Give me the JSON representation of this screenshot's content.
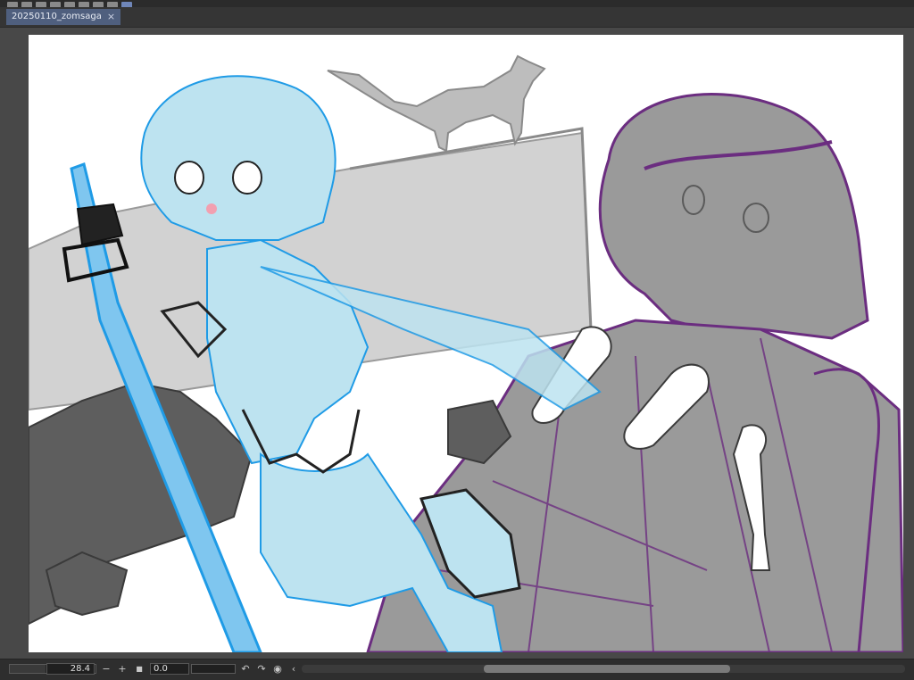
{
  "document": {
    "tab_label": "20250110_zomsaga",
    "close_glyph": "×"
  },
  "toolbar": {
    "icons": [
      "menu-icon",
      "save-icon",
      "undo-icon",
      "redo-icon",
      "transform-icon",
      "fill-icon",
      "ruler-icon",
      "snap-icon",
      "layer-icon"
    ]
  },
  "statusbar": {
    "zoom_value": "28.4",
    "zoom_out_glyph": "−",
    "zoom_in_glyph": "+",
    "fit_glyph": "■",
    "rotation_value": "0.0",
    "rotate_left_glyph": "↶",
    "rotate_right_glyph": "↷",
    "reset_rotation_glyph": "◉",
    "collapse_glyph": "‹"
  },
  "colors": {
    "canvas_bg": "#ffffff",
    "workspace_bg": "#484848",
    "tab_active": "#4f5f7e",
    "sketch_blue": "#bde3f0",
    "sketch_blue_line": "#1f9be6",
    "sketch_gray": "#8c8c8c",
    "sketch_purple": "#6b2d80"
  }
}
